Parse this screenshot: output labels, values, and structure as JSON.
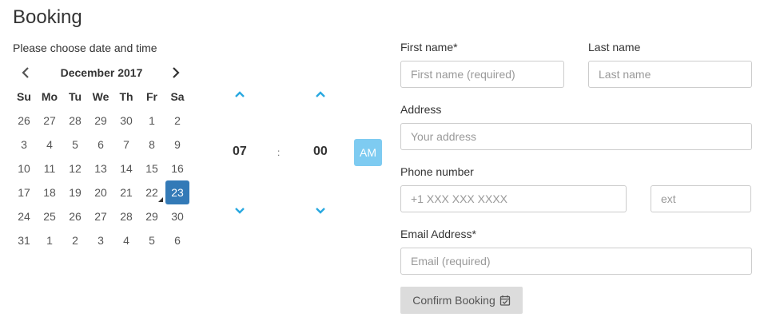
{
  "header": {
    "title": "Booking",
    "subtitle": "Please choose date and time"
  },
  "calendar": {
    "month_label": "December 2017",
    "weekdays": [
      "Su",
      "Mo",
      "Tu",
      "We",
      "Th",
      "Fr",
      "Sa"
    ],
    "days": [
      "26",
      "27",
      "28",
      "29",
      "30",
      "1",
      "2",
      "3",
      "4",
      "5",
      "6",
      "7",
      "8",
      "9",
      "10",
      "11",
      "12",
      "13",
      "14",
      "15",
      "16",
      "17",
      "18",
      "19",
      "20",
      "21",
      "22",
      "23",
      "24",
      "25",
      "26",
      "27",
      "28",
      "29",
      "30",
      "31",
      "1",
      "2",
      "3",
      "4",
      "5",
      "6"
    ],
    "selected_day": "23",
    "today_marker_day": "22",
    "selected_color": "#337ab7"
  },
  "time": {
    "hour": "07",
    "separator": ":",
    "minute": "00",
    "period": "AM",
    "accent": "#29a8e0"
  },
  "form": {
    "first_name": {
      "label": "First name*",
      "placeholder": "First name (required)"
    },
    "last_name": {
      "label": "Last name",
      "placeholder": "Last name"
    },
    "address": {
      "label": "Address",
      "placeholder": "Your address"
    },
    "phone": {
      "label": "Phone number",
      "placeholder": "+1 XXX XXX XXXX"
    },
    "ext": {
      "placeholder": "ext"
    },
    "email": {
      "label": "Email Address*",
      "placeholder": "Email (required)"
    },
    "submit_label": "Confirm Booking"
  },
  "icons": {
    "prev": "chevron-left-icon",
    "next": "chevron-right-icon",
    "up": "chevron-up-icon",
    "down": "chevron-down-icon",
    "submit": "calendar-check-icon"
  }
}
